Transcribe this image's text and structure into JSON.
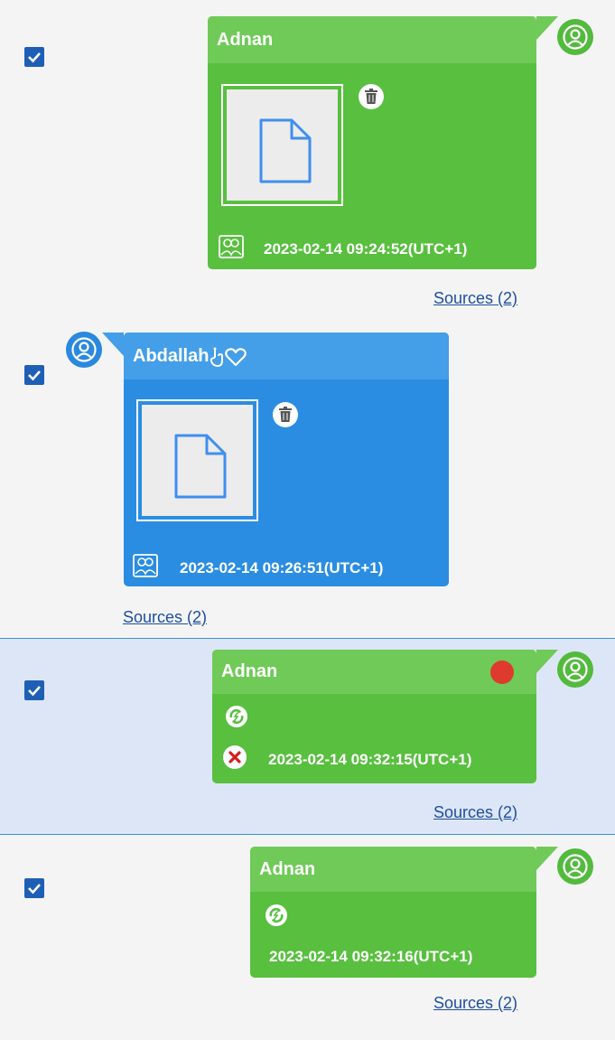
{
  "colors": {
    "sent_bubble": "#58bf3f",
    "received_bubble": "#2a8de2",
    "selected_row": "#dde6f6",
    "checkbox": "#1e5fb5",
    "recording_dot": "#de3a2e",
    "fail_icon": "#d41f1f"
  },
  "messages": [
    {
      "sender": "Adnan",
      "direction": "outgoing",
      "checked": true,
      "attachment": "file",
      "timestamp": "2023-02-14 09:24:52(UTC+1)",
      "sources": "Sources (2)"
    },
    {
      "sender": "Abdallah",
      "sender_icons": [
        "hand-icon",
        "heart-icon"
      ],
      "direction": "incoming",
      "checked": true,
      "attachment": "file",
      "timestamp": "2023-02-14 09:26:51(UTC+1)",
      "sources": "Sources (2)"
    },
    {
      "sender": "Adnan",
      "direction": "outgoing",
      "checked": true,
      "selected": true,
      "attachment": "sync",
      "status": "failed",
      "indicator": "red-dot",
      "timestamp": "2023-02-14 09:32:15(UTC+1)",
      "sources": "Sources (2)"
    },
    {
      "sender": "Adnan",
      "direction": "outgoing",
      "checked": true,
      "attachment": "sync",
      "timestamp": "2023-02-14 09:32:16(UTC+1)",
      "sources": "Sources (2)"
    }
  ]
}
